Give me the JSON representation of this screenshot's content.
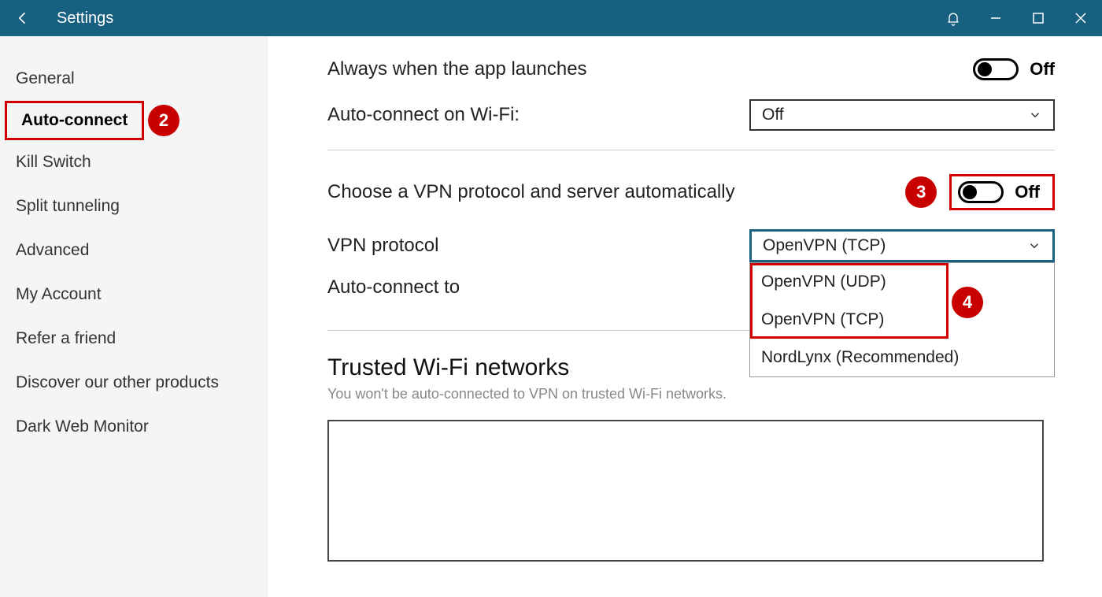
{
  "titlebar": {
    "title": "Settings"
  },
  "sidebar": {
    "items": [
      {
        "label": "General"
      },
      {
        "label": "Auto-connect",
        "active": true
      },
      {
        "label": "Kill Switch"
      },
      {
        "label": "Split tunneling"
      },
      {
        "label": "Advanced"
      },
      {
        "label": "My Account"
      },
      {
        "label": "Refer a friend"
      },
      {
        "label": "Discover our other products"
      },
      {
        "label": "Dark Web Monitor"
      }
    ]
  },
  "main": {
    "always_launch_label": "Always when the app launches",
    "always_launch_state": "Off",
    "auto_wifi_label": "Auto-connect on Wi-Fi:",
    "auto_wifi_value": "Off",
    "auto_protocol_label": "Choose a VPN protocol and server automatically",
    "auto_protocol_state": "Off",
    "vpn_protocol_label": "VPN protocol",
    "vpn_protocol_value": "OpenVPN (TCP)",
    "vpn_protocol_options": [
      "OpenVPN (UDP)",
      "OpenVPN (TCP)",
      "NordLynx (Recommended)"
    ],
    "auto_connect_to_label": "Auto-connect to",
    "trusted_title": "Trusted Wi-Fi networks",
    "trusted_sub": "You won't be auto-connected to VPN on trusted Wi-Fi networks."
  },
  "annotations": {
    "n2": "2",
    "n3": "3",
    "n4": "4"
  }
}
